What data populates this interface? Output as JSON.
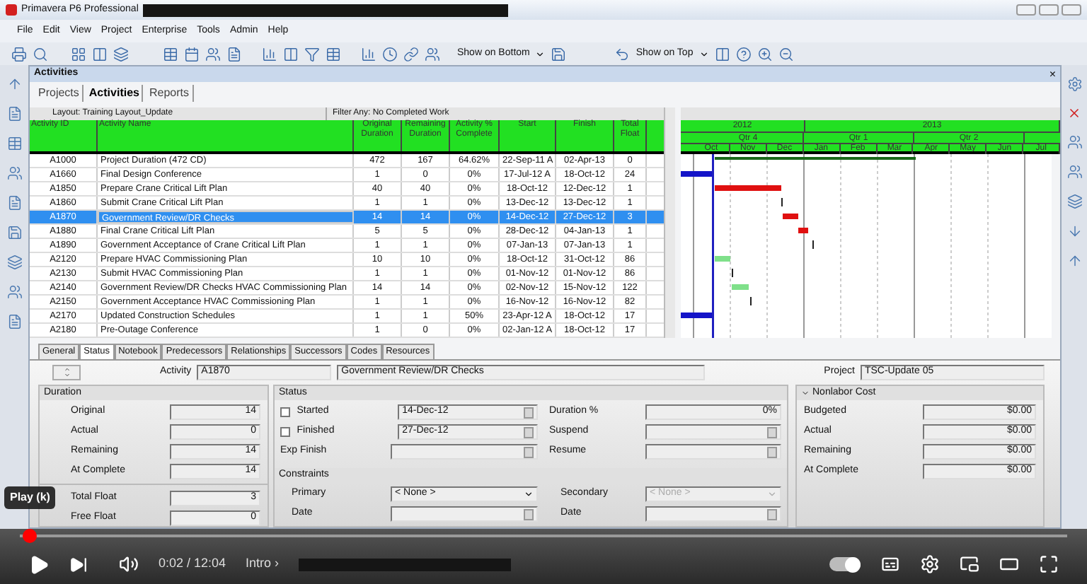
{
  "window": {
    "title": "Primavera P6 Professional"
  },
  "menu": [
    "File",
    "Edit",
    "View",
    "Project",
    "Enterprise",
    "Tools",
    "Admin",
    "Help"
  ],
  "toolbar": {
    "show_bottom": "Show on Bottom",
    "show_top": "Show on Top"
  },
  "panel": {
    "title": "Activities",
    "close": "×"
  },
  "tabs": [
    {
      "label": "Projects",
      "selected": false
    },
    {
      "label": "Activities",
      "selected": true
    },
    {
      "label": "Reports",
      "selected": false
    }
  ],
  "layout_bar": {
    "layout": "Layout: Training Layout_Update",
    "filter": "Filter Any: No Completed Work"
  },
  "table": {
    "columns": [
      "Activity ID",
      "Activity Name",
      "Original Duration",
      "Remaining Duration",
      "Activity % Complete",
      "Start",
      "Finish",
      "Total Float"
    ],
    "rows": [
      {
        "cells": [
          "A1000",
          "Project Duration (472 CD)",
          "472",
          "167",
          "64.62%",
          "22-Sep-11 A",
          "02-Apr-13",
          "0"
        ],
        "selected": false
      },
      {
        "cells": [
          "A1660",
          "Final Design Conference",
          "1",
          "0",
          "0%",
          "17-Jul-12 A",
          "18-Oct-12",
          "24"
        ],
        "selected": false
      },
      {
        "cells": [
          "A1850",
          "Prepare Crane Critical Lift Plan",
          "40",
          "40",
          "0%",
          "18-Oct-12",
          "12-Dec-12",
          "1"
        ],
        "selected": false
      },
      {
        "cells": [
          "A1860",
          "Submit Crane Critical Lift Plan",
          "1",
          "1",
          "0%",
          "13-Dec-12",
          "13-Dec-12",
          "1"
        ],
        "selected": false
      },
      {
        "cells": [
          "A1870",
          "Government Review/DR Checks",
          "14",
          "14",
          "0%",
          "14-Dec-12",
          "27-Dec-12",
          "3"
        ],
        "selected": true
      },
      {
        "cells": [
          "A1880",
          "Final Crane Critical Lift Plan",
          "5",
          "5",
          "0%",
          "28-Dec-12",
          "04-Jan-13",
          "1"
        ],
        "selected": false
      },
      {
        "cells": [
          "A1890",
          "Government Acceptance of Crane Critical Lift Plan",
          "1",
          "1",
          "0%",
          "07-Jan-13",
          "07-Jan-13",
          "1"
        ],
        "selected": false
      },
      {
        "cells": [
          "A2120",
          "Prepare HVAC Commissioning Plan",
          "10",
          "10",
          "0%",
          "18-Oct-12",
          "31-Oct-12",
          "86"
        ],
        "selected": false
      },
      {
        "cells": [
          "A2130",
          "Submit HVAC Commissioning Plan",
          "1",
          "1",
          "0%",
          "01-Nov-12",
          "01-Nov-12",
          "86"
        ],
        "selected": false
      },
      {
        "cells": [
          "A2140",
          "Government Review/DR Checks HVAC Commissioning Plan",
          "14",
          "14",
          "0%",
          "02-Nov-12",
          "15-Nov-12",
          "122"
        ],
        "selected": false
      },
      {
        "cells": [
          "A2150",
          "Government Acceptance HVAC Commissioning Plan",
          "1",
          "1",
          "0%",
          "16-Nov-12",
          "16-Nov-12",
          "82"
        ],
        "selected": false
      },
      {
        "cells": [
          "A2170",
          "Updated Construction Schedules",
          "1",
          "1",
          "50%",
          "23-Apr-12 A",
          "18-Oct-12",
          "17"
        ],
        "selected": false
      },
      {
        "cells": [
          "A2180",
          "Pre-Outage Conference",
          "1",
          "0",
          "0%",
          "02-Jan-12 A",
          "18-Oct-12",
          "17"
        ],
        "selected": false
      }
    ]
  },
  "timescale": {
    "years": [
      "2012",
      "2013"
    ],
    "quarters": [
      "Qtr 4",
      "Qtr 1",
      "Qtr 2"
    ],
    "months": [
      "Oct",
      "Nov",
      "Dec",
      "Jan",
      "Feb",
      "Mar",
      "Apr",
      "May",
      "Jun",
      "Jul"
    ]
  },
  "detail_tabs": [
    {
      "label": "General",
      "selected": false
    },
    {
      "label": "Status",
      "selected": true
    },
    {
      "label": "Notebook",
      "selected": false
    },
    {
      "label": "Predecessors",
      "selected": false
    },
    {
      "label": "Relationships",
      "selected": false
    },
    {
      "label": "Successors",
      "selected": false
    },
    {
      "label": "Codes",
      "selected": false
    },
    {
      "label": "Resources",
      "selected": false
    }
  ],
  "detail": {
    "activity_label": "Activity",
    "activity_id": "A1870",
    "activity_name": "Government Review/DR Checks",
    "project_label": "Project",
    "project": "TSC-Update 05",
    "duration": {
      "title": "Duration",
      "fields": [
        {
          "label": "Original",
          "value": "14"
        },
        {
          "label": "Actual",
          "value": "0"
        },
        {
          "label": "Remaining",
          "value": "14"
        },
        {
          "label": "At Complete",
          "value": "14"
        }
      ]
    },
    "float_fields": [
      {
        "label": "Total Float",
        "value": "3"
      },
      {
        "label": "Free Float",
        "value": "0"
      }
    ],
    "status": {
      "title": "Status",
      "dates": [
        {
          "kind": "check",
          "label": "Started",
          "checked": false,
          "value": "14-Dec-12"
        },
        {
          "kind": "check",
          "label": "Finished",
          "checked": false,
          "value": "27-Dec-12"
        },
        {
          "kind": "plain",
          "label": "Exp Finish"
        }
      ],
      "right": [
        {
          "kind": "value",
          "label": "Duration %",
          "value": "0%"
        },
        {
          "kind": "date",
          "label": "Suspend"
        },
        {
          "kind": "date",
          "label": "Resume"
        }
      ]
    },
    "constraints": {
      "title": "Constraints",
      "left": [
        {
          "kind": "select",
          "label": "Primary",
          "value": "< None >"
        },
        {
          "kind": "date",
          "label": "Date"
        }
      ],
      "right": [
        {
          "kind": "select",
          "label": "Secondary",
          "value": "< None >",
          "disabled": true
        },
        {
          "kind": "date",
          "label": "Date"
        }
      ]
    },
    "cost": {
      "title": "Nonlabor Cost",
      "fields": [
        {
          "label": "Budgeted",
          "value": "$0.00"
        },
        {
          "label": "Actual",
          "value": "$0.00"
        },
        {
          "label": "Remaining",
          "value": "$0.00"
        },
        {
          "label": "At Complete",
          "value": "$0.00"
        }
      ]
    }
  },
  "video": {
    "tooltip": "Play (k)",
    "time": "0:02 / 12:04",
    "chapter": "Intro ›",
    "progress": {
      "level": 0.003
    },
    "autoplay": {
      "on": true
    }
  }
}
